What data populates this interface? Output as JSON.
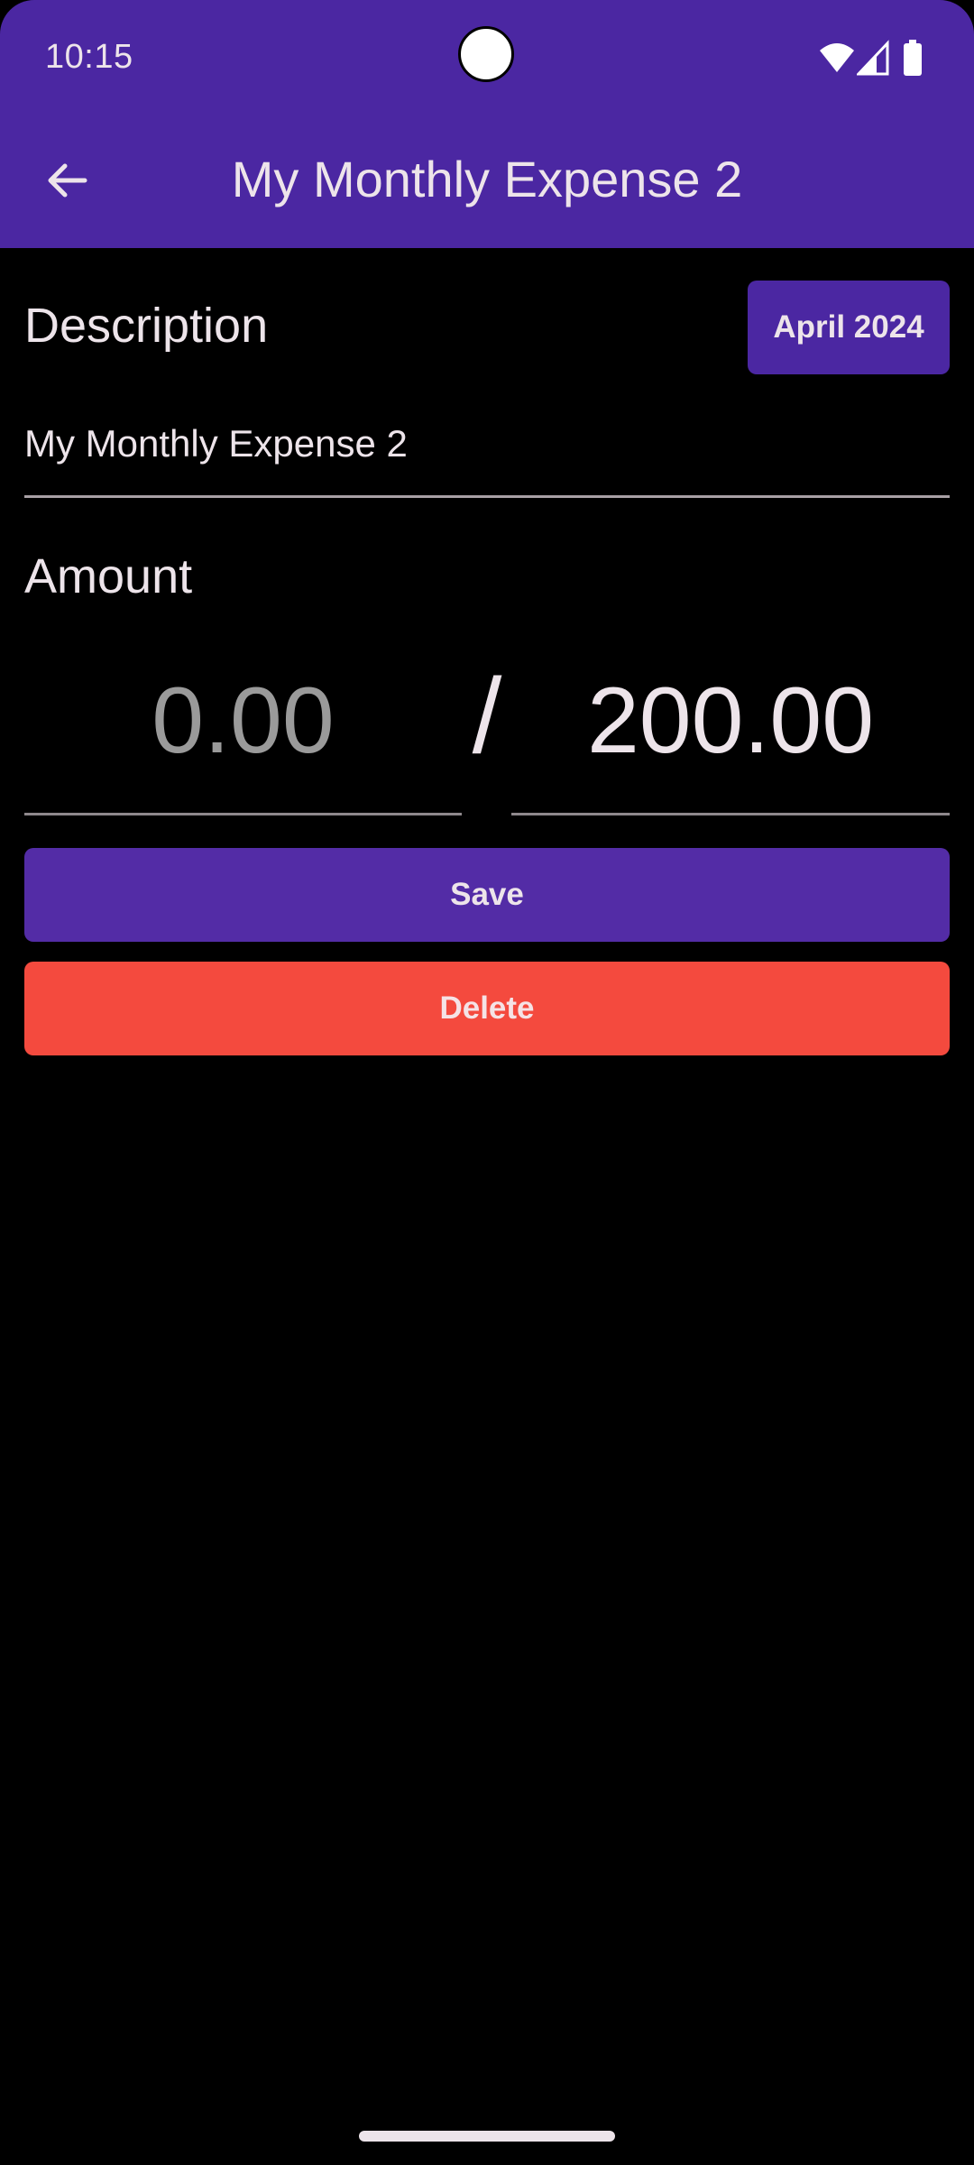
{
  "status_bar": {
    "time": "10:15",
    "icons": [
      "wifi-icon",
      "signal-icon",
      "battery-icon"
    ]
  },
  "app_bar": {
    "back_icon": "arrow-back-icon",
    "title": "My Monthly Expense 2"
  },
  "form": {
    "description_label": "Description",
    "month_button": "April 2024",
    "description_value": "My Monthly Expense 2",
    "amount_label": "Amount",
    "amount_spent": "0.00",
    "amount_separator": "/",
    "amount_budget": "200.00"
  },
  "actions": {
    "save_label": "Save",
    "delete_label": "Delete"
  },
  "colors": {
    "primary": "#4B27A2",
    "save": "#532CA6",
    "danger": "#F44A3E",
    "background": "#000000",
    "text": "#EDE4EA"
  }
}
